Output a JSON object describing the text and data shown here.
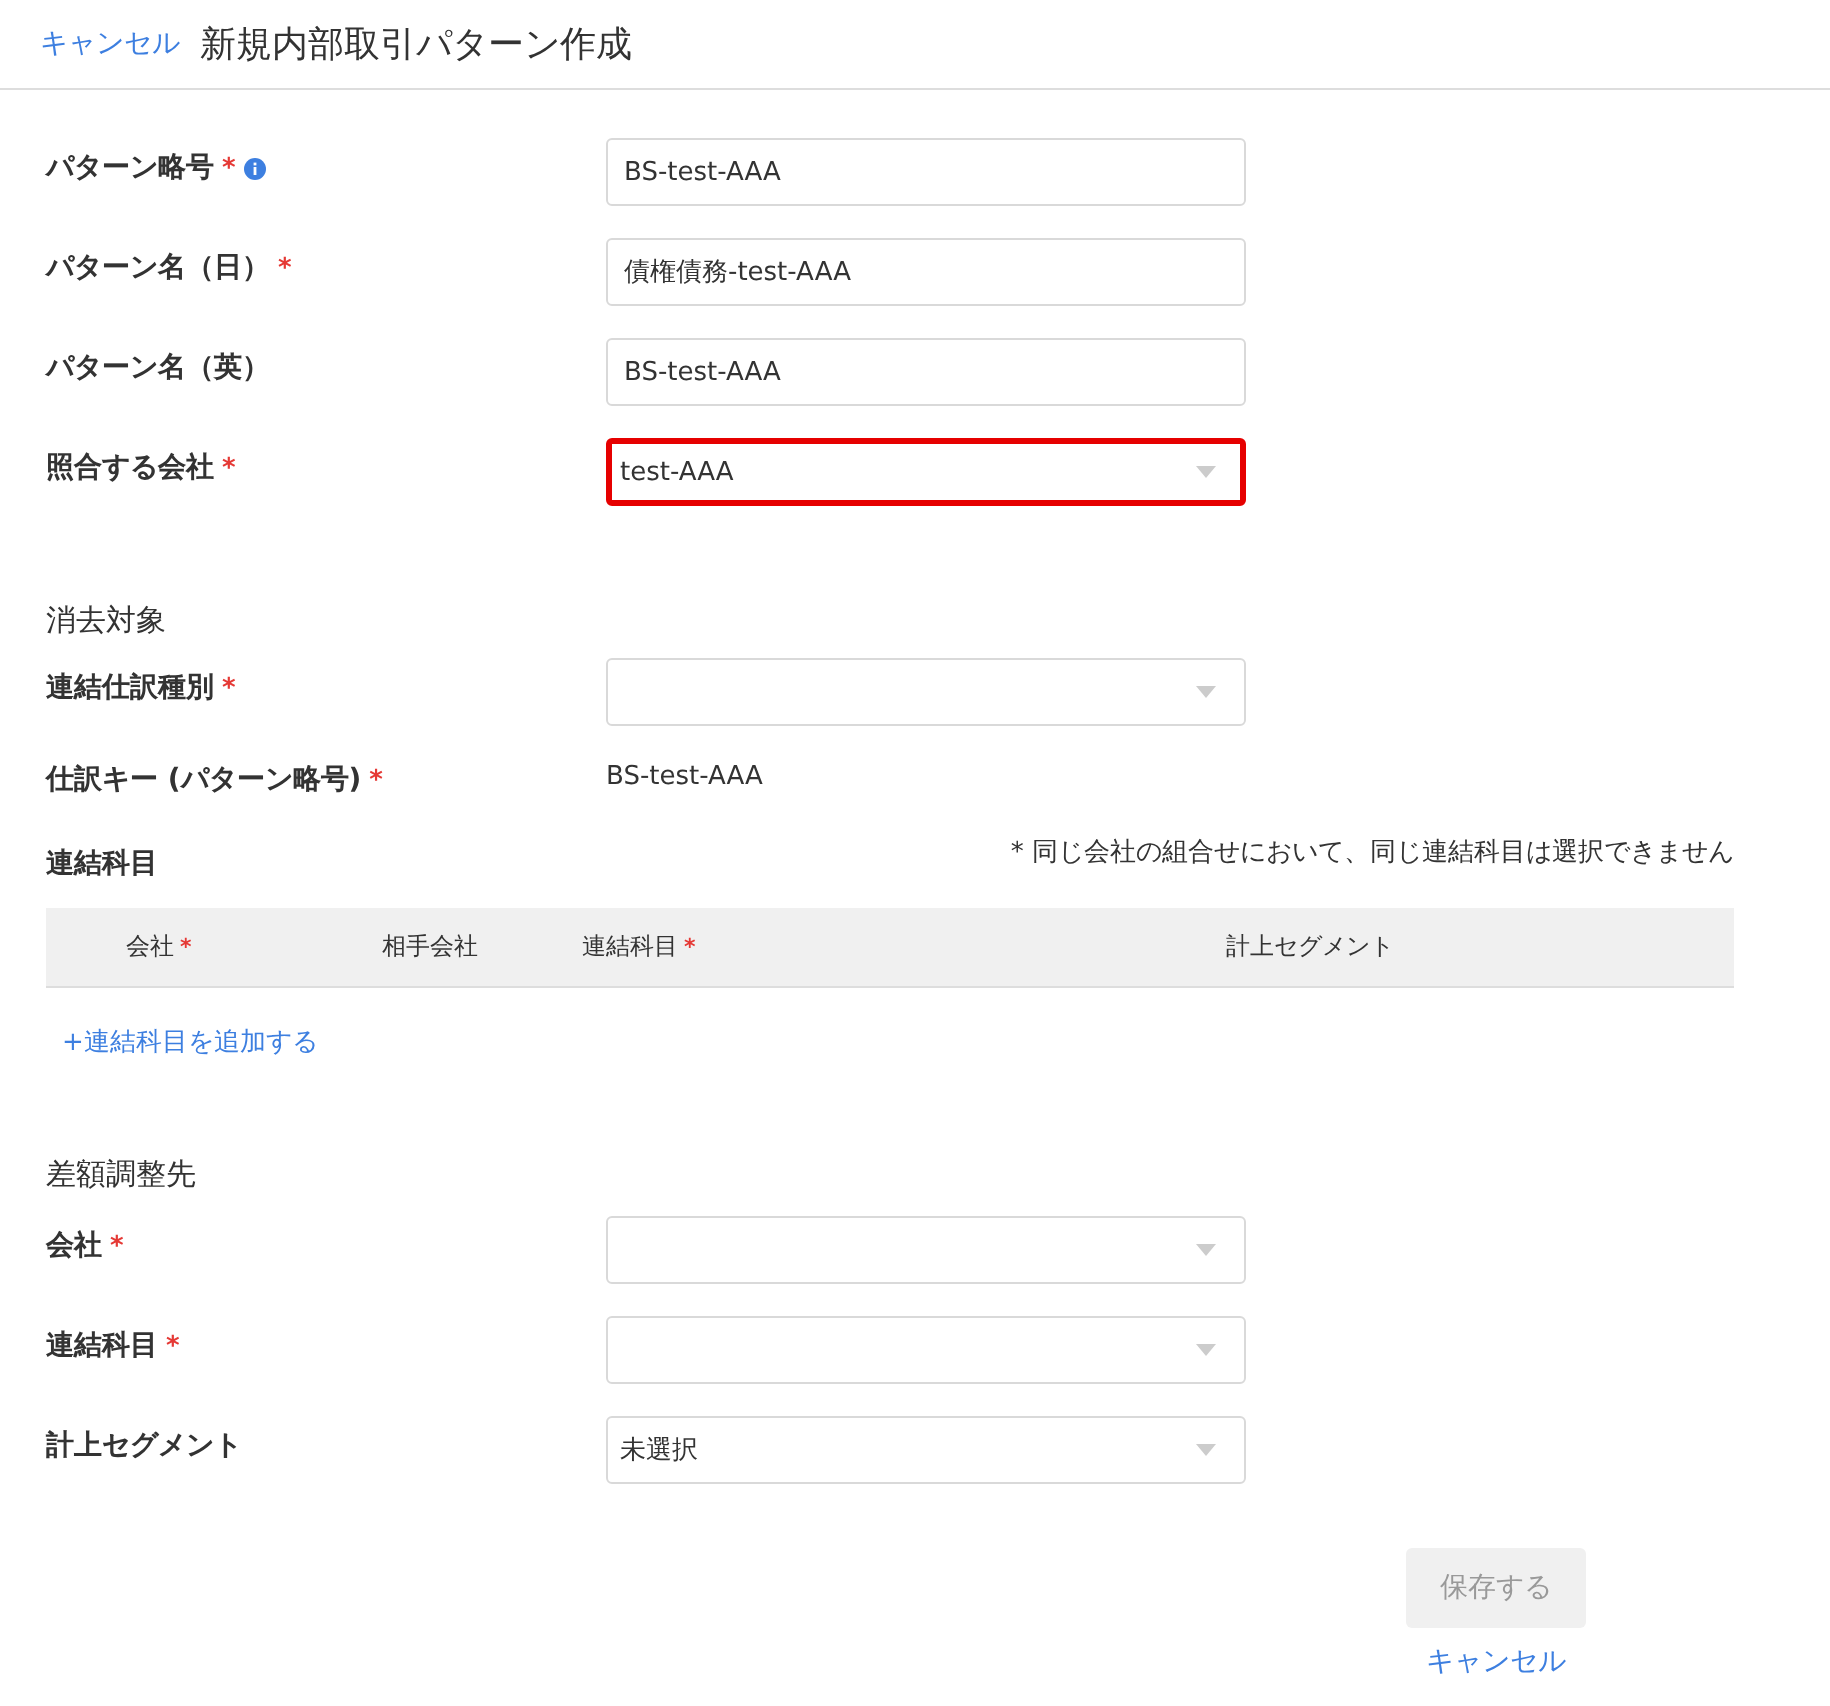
{
  "header": {
    "cancel": "キャンセル",
    "title": "新規内部取引パターン作成"
  },
  "fields": [
    {
      "label": "パターン略号",
      "required_mark": "*",
      "info": true,
      "kind": "text",
      "value": "BS-test-AAA",
      "highlighted": false
    },
    {
      "label": "パターン名（日）",
      "required_mark": "*",
      "info": false,
      "kind": "text",
      "value": "債権債務-test-AAA",
      "highlighted": false
    },
    {
      "label": "パターン名（英）",
      "info": false,
      "kind": "text",
      "value": "BS-test-AAA",
      "highlighted": false
    },
    {
      "label": "照合する会社",
      "required_mark": "*",
      "info": false,
      "kind": "select",
      "value": "test-AAA",
      "highlighted": true
    }
  ],
  "elimination": {
    "heading": "消去対象",
    "fields": [
      {
        "label": "連結仕訳種別",
        "required_mark": "*",
        "info": false,
        "kind": "select",
        "highlighted": false
      }
    ],
    "key": {
      "label": "仕訳キー (パターン略号)",
      "required_mark": "*",
      "value": "BS-test-AAA"
    },
    "accounts": {
      "label": "連結科目",
      "note": "* 同じ会社の組合せにおいて、同じ連結科目は選択できません",
      "columns": [
        {
          "label": "会社",
          "required_mark": "*"
        },
        {
          "label": "相手会社"
        },
        {
          "label": "連結科目",
          "required_mark": "*"
        },
        {
          "label": "計上セグメント"
        }
      ],
      "add_link": "+連結科目を追加する"
    }
  },
  "adjustment": {
    "heading": "差額調整先",
    "fields": [
      {
        "label": "会社",
        "required_mark": "*",
        "info": false,
        "kind": "select",
        "highlighted": false
      },
      {
        "label": "連結科目",
        "required_mark": "*",
        "info": false,
        "kind": "select",
        "highlighted": false
      },
      {
        "label": "計上セグメント",
        "info": false,
        "kind": "select",
        "value": "未選択",
        "highlighted": false
      }
    ]
  },
  "actions": {
    "save": {
      "label": "保存する",
      "disabled": true
    },
    "cancel": "キャンセル"
  }
}
